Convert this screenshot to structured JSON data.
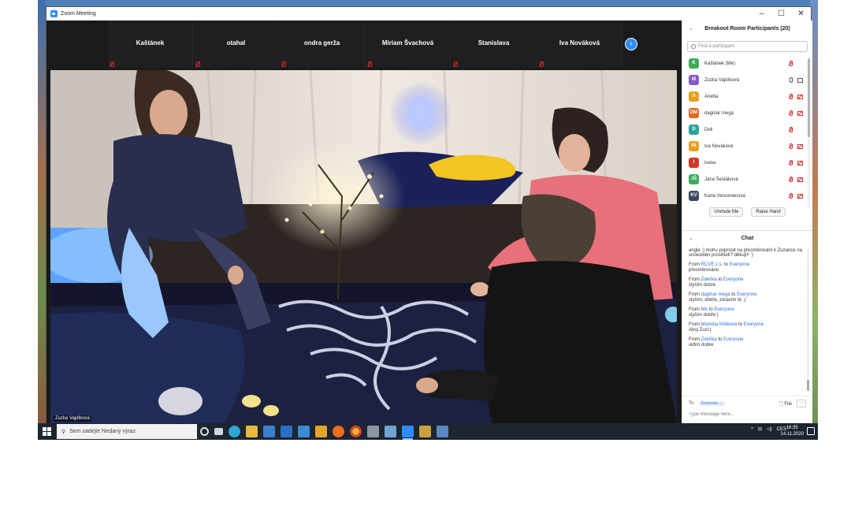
{
  "window": {
    "title": "Zoom Meeting"
  },
  "gallery": {
    "thumbnails": [
      {
        "name": "Kaštánek"
      },
      {
        "name": "otahal"
      },
      {
        "name": "ondra gerža"
      },
      {
        "name": "Miriam Švachová"
      },
      {
        "name": "Stanislava"
      },
      {
        "name": "Iva Nováková"
      }
    ]
  },
  "main_video": {
    "speaker_name": "Zuzka Vajdíková"
  },
  "participants_panel": {
    "title": "Breakout Room Participants (20)",
    "search_placeholder": "Find a participant",
    "participants": [
      {
        "initials": "K",
        "name": "Kaštánek (Me)",
        "color": "#3dab5a",
        "mic": "muted",
        "cam": ""
      },
      {
        "initials": "M",
        "name": "Zuzka Vajdíková",
        "color": "#8a5cc7",
        "mic": "on",
        "cam": "on"
      },
      {
        "initials": "A",
        "name": "Anetta",
        "color": "#e8a020",
        "mic": "muted",
        "cam": "muted"
      },
      {
        "initials": "DM",
        "name": "dagmar mega",
        "color": "#e06a1f",
        "mic": "muted",
        "cam": "muted"
      },
      {
        "initials": "D",
        "name": "Dell",
        "color": "#2aa59a",
        "mic": "muted",
        "cam": ""
      },
      {
        "initials": "IN",
        "name": "Iva Nováková",
        "color": "#e8a020",
        "mic": "muted",
        "cam": "muted"
      },
      {
        "initials": "I",
        "name": "ivana",
        "color": "#d23a2a",
        "mic": "muted",
        "cam": "muted"
      },
      {
        "initials": "JŠ",
        "name": "Jana Šestáková",
        "color": "#3dab5a",
        "mic": "muted",
        "cam": "muted"
      },
      {
        "initials": "KV",
        "name": "Karla Vencenecová",
        "color": "#3b4a5c",
        "mic": "muted",
        "cam": "muted"
      }
    ],
    "unmute_label": "Unmute Me",
    "raise_hand_label": "Raise Hand"
  },
  "chat": {
    "title": "Chat",
    "partial_message": "angle :) mohu poprosit na přesměrování k Zuzance na snoezelen prostředí? děkuji!! :)",
    "messages": [
      {
        "from": "RCVE z.s.",
        "to": "Everyone",
        "text": "přesměrováno"
      },
      {
        "from": "Zdeňka",
        "to": "Everyone",
        "text": "slyším dobre"
      },
      {
        "from": "dagmar mega",
        "to": "Everyone",
        "text": "slyším, dobře, zdravím tě :)"
      },
      {
        "from": "Me",
        "to": "Everyone",
        "text": "slyším dobře:)"
      },
      {
        "from": "Markéta Klišková",
        "to": "Everyone",
        "text": "Ahoj Zuzi:)"
      },
      {
        "from": "Zdeňka",
        "to": "Everyone",
        "text": "vidím dobre"
      }
    ],
    "from_word": "From",
    "to_word": "to",
    "to_label": "To:",
    "to_value": "Everyone ⌄",
    "file_label": "File",
    "more_label": "···",
    "input_placeholder": "Type message here..."
  },
  "taskbar": {
    "search_placeholder": "Sem zadejte hledaný výraz",
    "lang": "CES",
    "time": "16:35",
    "date": "14.11.2020"
  }
}
